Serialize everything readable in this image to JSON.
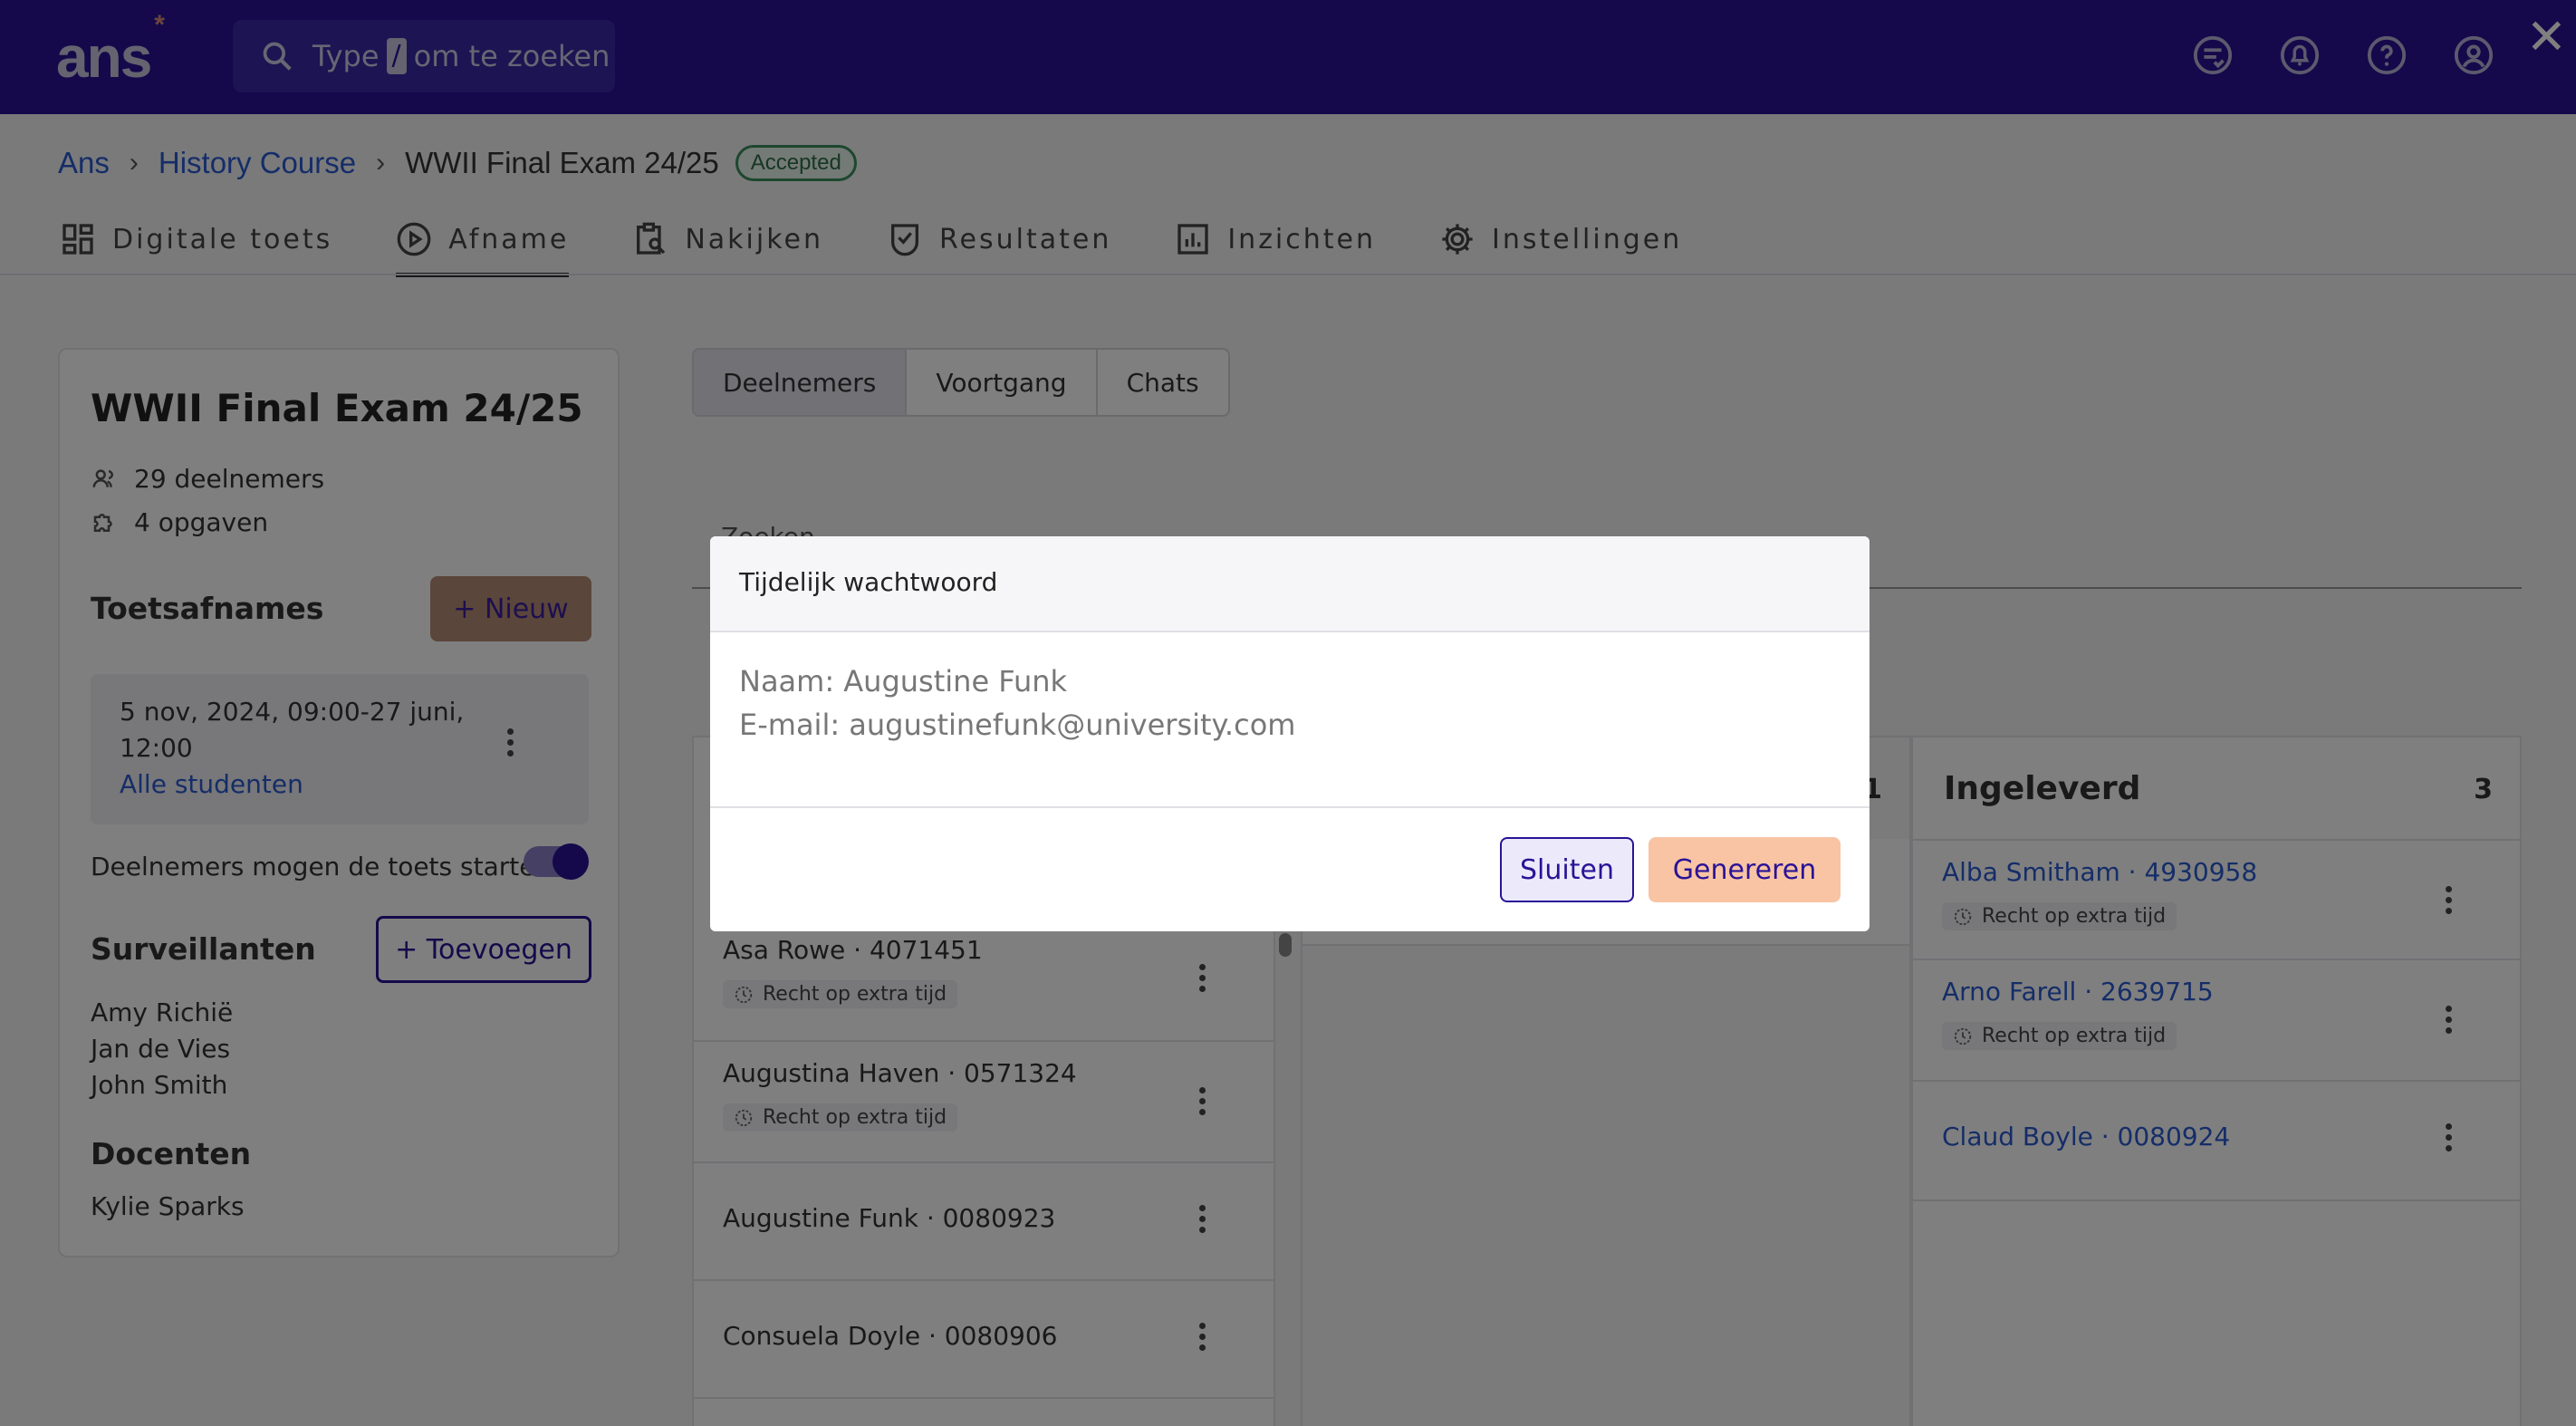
{
  "topbar": {
    "logo": "ans",
    "logo_mark": "*",
    "search_pre": "Type",
    "search_key": "/",
    "search_post": "om te zoeken",
    "icons": [
      "checklist-icon",
      "bell-icon",
      "help-icon",
      "user-icon"
    ],
    "close": "✕"
  },
  "breadcrumb": {
    "items": [
      "Ans",
      "History Course"
    ],
    "current": "WWII Final Exam 24/25",
    "badge": "Accepted"
  },
  "tabs": [
    {
      "label": "Digitale toets"
    },
    {
      "label": "Afname"
    },
    {
      "label": "Nakijken"
    },
    {
      "label": "Resultaten"
    },
    {
      "label": "Inzichten"
    },
    {
      "label": "Instellingen"
    }
  ],
  "left": {
    "title": "WWII Final Exam 24/25",
    "participants": "29 deelnemers",
    "tasks": "4 opgaven",
    "sessions_title": "Toetsafnames",
    "new_button": "+ Nieuw",
    "session_line1": "5 nov, 2024, 09:00-27 juni,",
    "session_line2": "12:00",
    "session_link": "Alle studenten",
    "toggle_label": "Deelnemers mogen de toets starten",
    "proctors_title": "Surveillanten",
    "add_button": "+ Toevoegen",
    "proctors": [
      "Amy Richië",
      "Jan de Vies",
      "John Smith"
    ],
    "teachers_title": "Docenten",
    "teachers": [
      "Kylie Sparks"
    ]
  },
  "subtabs": [
    "Deelnemers",
    "Voortgang",
    "Chats"
  ],
  "search_placeholder": "Zoeken",
  "columns": {
    "left_rows": [
      {
        "name": "Asa Rowe · 4071451",
        "tag": "Recht op extra tijd"
      },
      {
        "name": "Augustina Haven · 0571324",
        "tag": "Recht op extra tijd"
      },
      {
        "name": "Augustine Funk · 0080923",
        "tag": ""
      },
      {
        "name": "Consuela Doyle · 0080906",
        "tag": ""
      }
    ],
    "mid_count": "1",
    "right_title": "Ingeleverd",
    "right_count": "3",
    "right_rows": [
      {
        "name": "Alba Smitham · 4930958",
        "tag": "Recht op extra tijd"
      },
      {
        "name": "Arno Farell · 2639715",
        "tag": "Recht op extra tijd"
      },
      {
        "name": "Claud Boyle · 0080924",
        "tag": ""
      }
    ]
  },
  "modal": {
    "title": "Tijdelijk wachtwoord",
    "name_line": "Naam: Augustine Funk",
    "email_line": "E-mail: augustinefunk@university.com",
    "close_button": "Sluiten",
    "generate_button": "Genereren"
  }
}
